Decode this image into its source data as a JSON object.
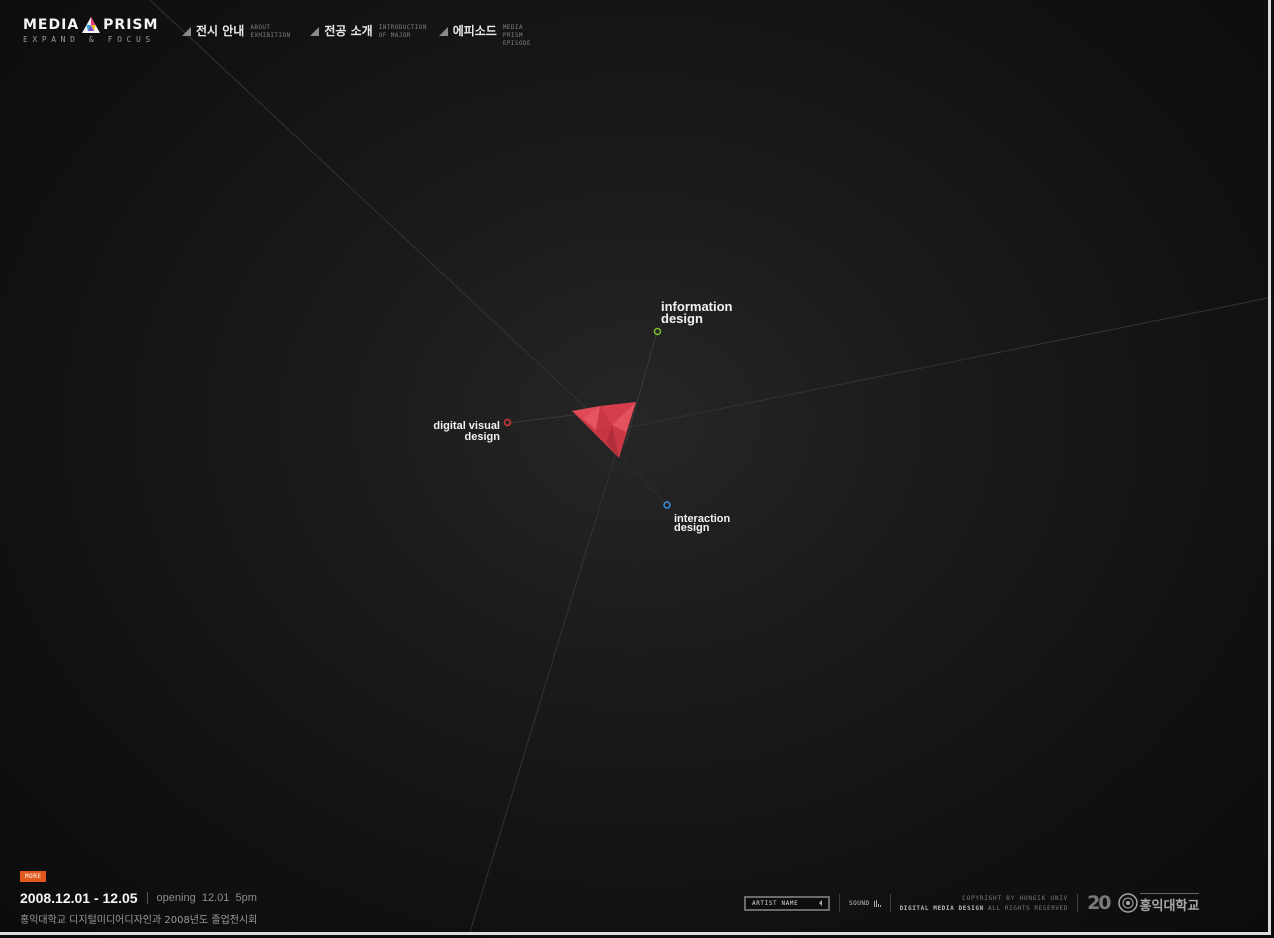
{
  "brand": {
    "name_left": "MEDIA",
    "name_right": "PRISM",
    "tagline": "EXPAND & FOCUS"
  },
  "nav": [
    {
      "ko": "전시 안내",
      "en1": "ABOUT",
      "en2": "EXHIBITION"
    },
    {
      "ko": "전공 소개",
      "en1": "INTRODUCTION",
      "en2": "OF MAJOR"
    },
    {
      "ko": "에피소드",
      "en1": "MEDIA PRISM",
      "en2": "EPISODE"
    }
  ],
  "majors": {
    "information": {
      "line1": "information",
      "line2": "design",
      "color": "#7fbf2a"
    },
    "digital_visual": {
      "line1": "digital visual",
      "line2": "design",
      "color": "#d9333a"
    },
    "interaction": {
      "line1": "interaction",
      "line2": "design",
      "color": "#3d8fe0"
    }
  },
  "prism_color": "#d8404c",
  "info": {
    "more_label": "MORE",
    "date": "2008.12.01 - 12.05",
    "opening_label": "opening",
    "opening_date": "12.01",
    "opening_time": "5pm",
    "subtitle": "홍익대학교 디지털미디어디자인과 2008년도 졸업전시회"
  },
  "footer": {
    "artist_label": "ARTIST NAME",
    "sound_label": "SOUND",
    "copyright": "COPYRIGHT BY HONGIK UNIV",
    "dept": "DIGITAL MEDIA DESIGN",
    "rights": "ALL RIGHTS RESERVED",
    "anniversary": "20",
    "university": "홍익대학교"
  },
  "accent_color": "#e2571b"
}
